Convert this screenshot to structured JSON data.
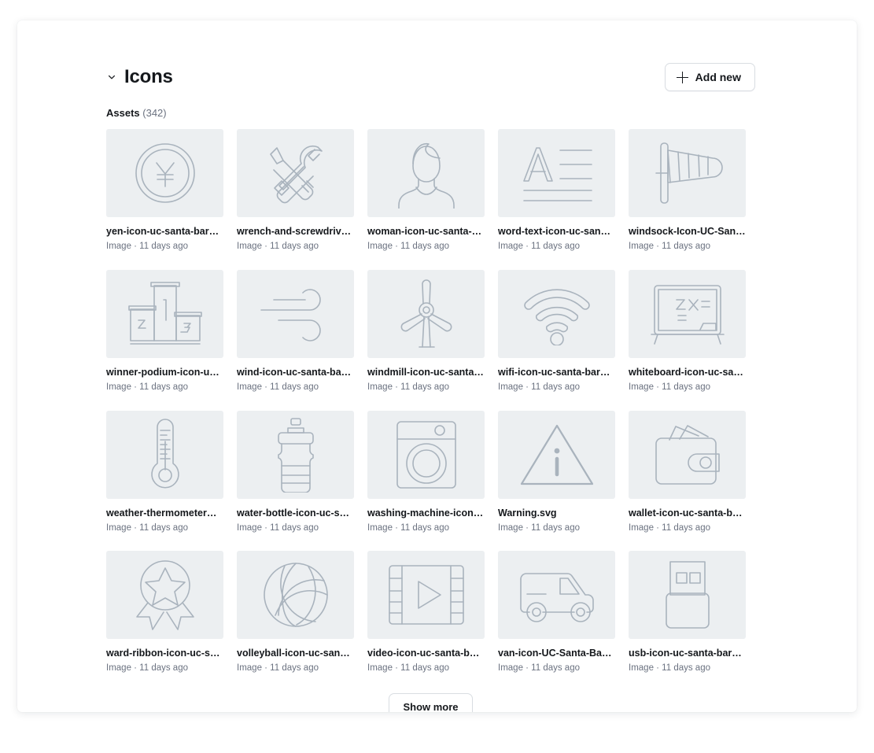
{
  "header": {
    "collapse_icon": "chevron-down-icon",
    "title": "Icons",
    "add_new_label": "Add new",
    "add_new_icon": "plus-icon"
  },
  "assets_summary": {
    "label": "Assets",
    "count": "(342)"
  },
  "assets": [
    {
      "name": "yen-icon-uc-santa-bar…",
      "meta": "Image · 11 days ago",
      "icon": "yen-coin-icon"
    },
    {
      "name": "wrench-and-screwdriv…",
      "meta": "Image · 11 days ago",
      "icon": "wrench-and-screwdriver-icon"
    },
    {
      "name": "woman-icon-uc-santa-…",
      "meta": "Image · 11 days ago",
      "icon": "woman-icon"
    },
    {
      "name": "word-text-icon-uc-san…",
      "meta": "Image · 11 days ago",
      "icon": "word-text-icon"
    },
    {
      "name": "windsock-Icon-UC-San…",
      "meta": "Image · 11 days ago",
      "icon": "windsock-icon"
    },
    {
      "name": "winner-podium-icon-u…",
      "meta": "Image · 11 days ago",
      "icon": "winner-podium-icon"
    },
    {
      "name": "wind-icon-uc-santa-ba…",
      "meta": "Image · 11 days ago",
      "icon": "wind-icon"
    },
    {
      "name": "windmill-icon-uc-santa…",
      "meta": "Image · 11 days ago",
      "icon": "windmill-icon"
    },
    {
      "name": "wifi-icon-uc-santa-bar…",
      "meta": "Image · 11 days ago",
      "icon": "wifi-icon"
    },
    {
      "name": "whiteboard-icon-uc-sa…",
      "meta": "Image · 11 days ago",
      "icon": "whiteboard-icon"
    },
    {
      "name": "weather-thermometer…",
      "meta": "Image · 11 days ago",
      "icon": "thermometer-icon"
    },
    {
      "name": "water-bottle-icon-uc-s…",
      "meta": "Image · 11 days ago",
      "icon": "water-bottle-icon"
    },
    {
      "name": "washing-machine-icon…",
      "meta": "Image · 11 days ago",
      "icon": "washing-machine-icon"
    },
    {
      "name": "Warning.svg",
      "meta": "Image · 11 days ago",
      "icon": "warning-triangle-icon"
    },
    {
      "name": "wallet-icon-uc-santa-b…",
      "meta": "Image · 11 days ago",
      "icon": "wallet-icon"
    },
    {
      "name": "ward-ribbon-icon-uc-s…",
      "meta": "Image · 11 days ago",
      "icon": "award-ribbon-icon"
    },
    {
      "name": "volleyball-icon-uc-san…",
      "meta": "Image · 11 days ago",
      "icon": "volleyball-icon"
    },
    {
      "name": "video-icon-uc-santa-b…",
      "meta": "Image · 11 days ago",
      "icon": "video-filmstrip-icon"
    },
    {
      "name": "van-icon-UC-Santa-Ba…",
      "meta": "Image · 11 days ago",
      "icon": "van-icon"
    },
    {
      "name": "usb-icon-uc-santa-bar…",
      "meta": "Image · 11 days ago",
      "icon": "usb-icon"
    }
  ],
  "footer": {
    "show_more_label": "Show more"
  },
  "colors": {
    "thumb_background": "#eceff1",
    "icon_stroke": "#a9b3bd",
    "text_primary": "#15181c",
    "text_secondary": "#6b7280",
    "card_background": "#ffffff",
    "border": "#d9dde2"
  },
  "whiteboard_text": "2x2="
}
